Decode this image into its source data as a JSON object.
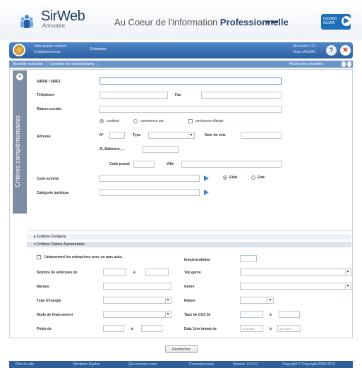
{
  "header": {
    "logo_text": "SirWeb",
    "logo_sub": "Annuaire",
    "tagline_prefix": "Au Coeur de l'information ",
    "tagline_bold": "Professionnelle",
    "top_button": "GUIDES ALERA"
  },
  "userbar": {
    "user_line1": "Votre panier contient",
    "user_line2": "3 établissements",
    "mid": "Entreprise",
    "right_line1": "Mis fourni: CO",
    "right_line2": "Vous LAUSAC",
    "help": "?",
    "close": "✕"
  },
  "tabs": {
    "new_search": "Nouvelle recherche",
    "nomenclature": "Consulter les nomenclatures",
    "recent": "Recherches récentes"
  },
  "sidebar": {
    "title": "Critères complémentaires",
    "toggle": "●"
  },
  "form": {
    "siren_label": "SIREN / SIRET",
    "tel_label": "Téléphone",
    "fax_label": "Fax",
    "raison_label": "Raison sociale",
    "opt_contient": "contient",
    "opt_commence": "commence par",
    "opt_pertinence": "pertinence élargie",
    "adresse_label": "Adresse",
    "num_label": "N°",
    "type_label": "Type",
    "nom_voie_label": "Nom de voie",
    "zi_label": "ZI, Bâtiment, ...",
    "cp_label": "Code postal",
    "ville_label": "Ville",
    "code_activite_label": "Code activité",
    "etab_label": "Etab.",
    "entr_label": "Entr.",
    "cat_jur_label": "Catégorie juridique"
  },
  "sections": {
    "contacts": "Critères Contacts",
    "flottes": "Critères Flottes Automobiles"
  },
  "flottes": {
    "only_parc": "Uniquement les entreprises avec un parc auto.",
    "immat_label": "Immatriculation",
    "nb_vehicules_label": "Nombre de véhicules de",
    "a": "à",
    "top_genre_label": "Top genre",
    "marque_label": "Marque",
    "genre_label": "Genre",
    "type_energie_label": "Type d'énergie",
    "nature_label": "Nature",
    "mode_fin_label": "Mode de financement",
    "taux_co2_label": "Taux de CO2 de",
    "poids_label": "Poids de",
    "date_label": "Date 1ère immat de",
    "date_placeholder": "AAAAMM"
  },
  "search_button": "Rechercher",
  "footer": {
    "links": [
      "Plan du site",
      "Mentions légales",
      "Qui sommes-nous",
      "Contactez-nous",
      "Version: 2.0.0.0",
      "Copyright © Copyright 2000-2013"
    ]
  },
  "colors": {
    "brand_blue": "#2d5f9e",
    "accent_blue": "#3a86d6",
    "close_red": "#c8102e"
  }
}
